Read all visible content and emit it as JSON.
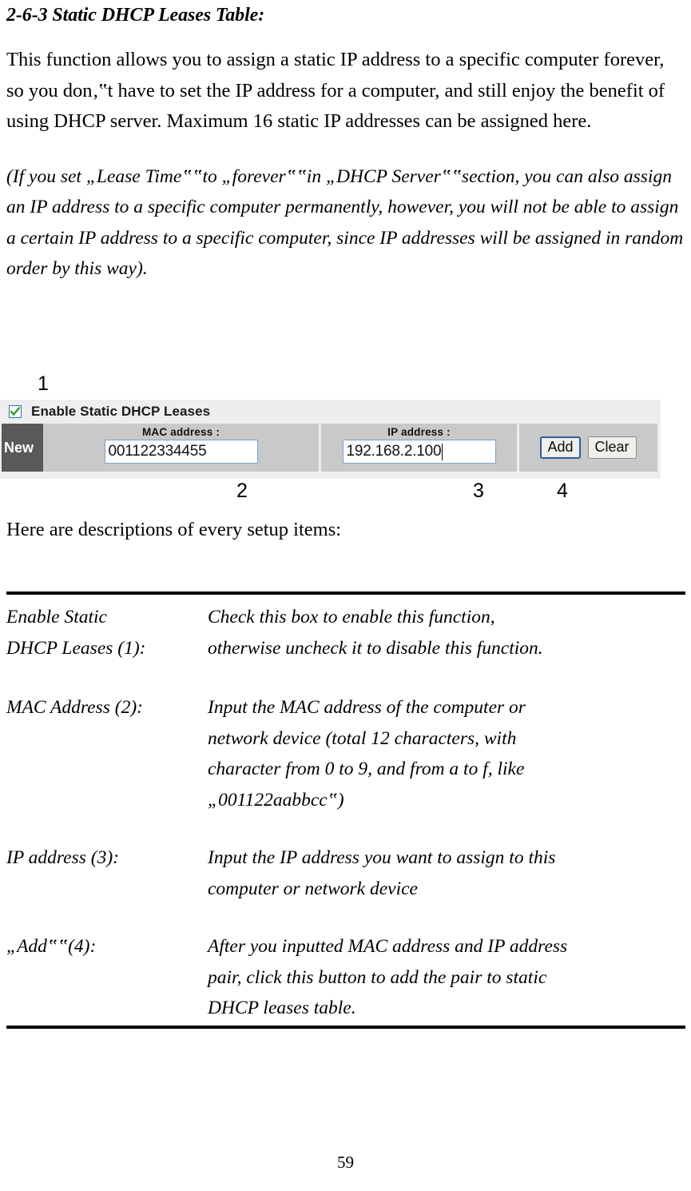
{
  "document": {
    "heading": "2-6-3 Static DHCP Leases Table:",
    "intro_paragraph": "This function allows you to assign a static IP address to a specific computer forever, so you don‚‟t have to set the IP address for a computer, and still enjoy the benefit of using DHCP server. Maximum 16 static IP addresses can be assigned here.",
    "note_paragraph": "(If you set „Lease Time‟‟to „forever‟‟in „DHCP Server‟‟section, you can also assign an IP address to a specific computer permanently, however, you will not be able to assign a certain IP address to a specific computer, since IP addresses will be assigned in random order by this way).",
    "descriptions_lead": "Here are descriptions of every setup items:",
    "page_number": "59"
  },
  "callouts": {
    "one": "1",
    "two": "2",
    "three": "3",
    "four": "4"
  },
  "router_ui": {
    "enable_label": "Enable Static DHCP Leases",
    "enable_checked": true,
    "checkbox_icon": "checkmark-icon",
    "row_label": "New",
    "mac": {
      "label": "MAC address :",
      "value": "001122334455"
    },
    "ip": {
      "label": "IP address :",
      "value": "192.168.2.100"
    },
    "buttons": {
      "add": "Add",
      "clear": "Clear"
    },
    "colors": {
      "panel_bg": "#eeeeee",
      "cell_bg": "#c9c9c9",
      "new_cell_bg": "#595959",
      "checkbox_border": "#3b6ea5",
      "check_color": "#22a02a",
      "primary_button_border": "#2d5d9e"
    }
  },
  "descriptions": [
    {
      "term_lines": [
        "Enable Static",
        "DHCP Leases (1):"
      ],
      "def_lines": [
        "Check this box to enable this function,",
        "otherwise uncheck it to disable this function."
      ]
    },
    {
      "term_lines": [
        "MAC Address (2):"
      ],
      "def_lines": [
        "Input the MAC address of the computer or",
        "network device (total 12 characters, with",
        "character from 0 to 9, and from a to f, like",
        "„001122aabbcc‟)"
      ]
    },
    {
      "term_lines": [
        "IP address (3):"
      ],
      "def_lines": [
        "Input the IP address you want to assign to this",
        "computer or network device"
      ]
    },
    {
      "term_lines": [
        "„Add‟‟(4):"
      ],
      "def_lines": [
        "After you inputted MAC address and IP address",
        "pair, click this button to add the pair to static",
        "DHCP leases table."
      ]
    }
  ]
}
